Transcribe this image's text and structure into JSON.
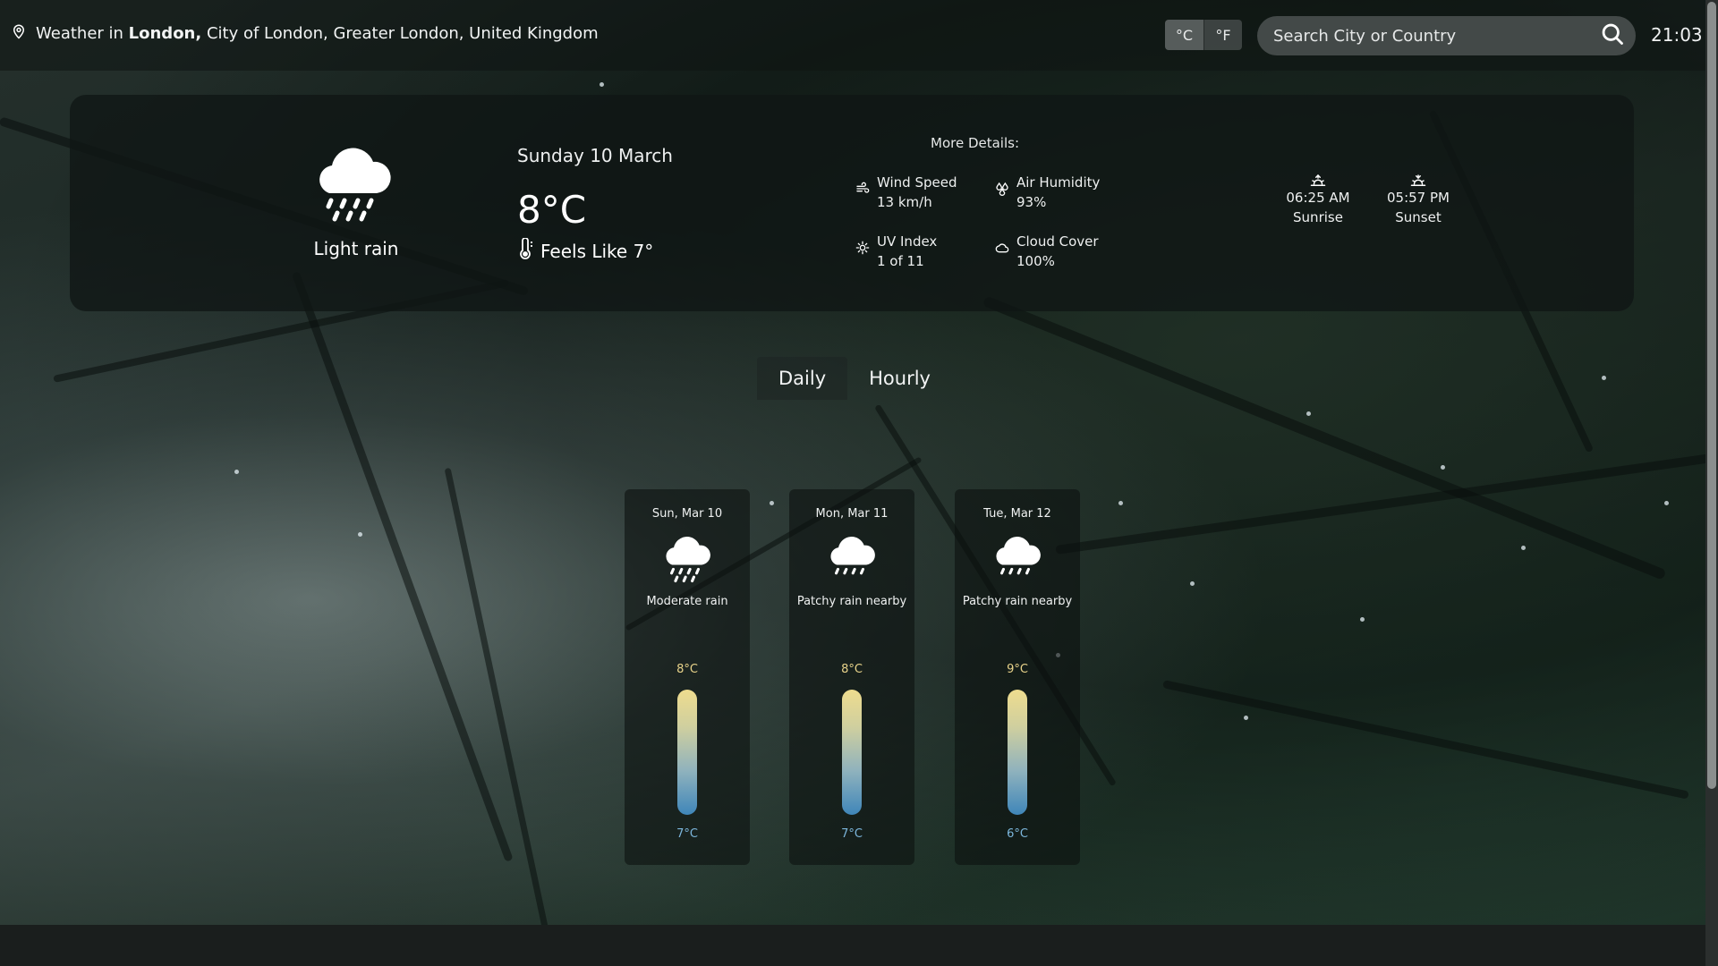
{
  "location": {
    "prefix": "Weather in",
    "city": "London,",
    "region": "City of London, Greater London, United Kingdom"
  },
  "units": {
    "celsius": "°C",
    "fahrenheit": "°F",
    "selected": "°C"
  },
  "search": {
    "placeholder": "Search City or Country",
    "value": ""
  },
  "clock": "21:03",
  "current": {
    "condition": "Light rain",
    "condition_icon": "rain-cloud-icon",
    "date": "Sunday 10 March",
    "temp": "8°C",
    "feels_like": "Feels Like 7°",
    "more_details_title": "More Details:",
    "details": {
      "wind_label": "Wind Speed",
      "wind_value": "13 km/h",
      "humidity_label": "Air Humidity",
      "humidity_value": "93%",
      "uv_label": "UV Index",
      "uv_value": "1 of 11",
      "cloud_label": "Cloud Cover",
      "cloud_value": "100%"
    },
    "sunrise_time": "06:25 AM",
    "sunrise_label": "Sunrise",
    "sunset_time": "05:57 PM",
    "sunset_label": "Sunset"
  },
  "tabs": {
    "daily": "Daily",
    "hourly": "Hourly",
    "active": "Daily"
  },
  "forecast": [
    {
      "day": "Sun, Mar 10",
      "condition": "Moderate rain",
      "high": "8°C",
      "low": "7°C",
      "icon": "rain-cloud-icon"
    },
    {
      "day": "Mon, Mar 11",
      "condition": "Patchy rain nearby",
      "high": "8°C",
      "low": "7°C",
      "icon": "rain-cloud-icon"
    },
    {
      "day": "Tue, Mar 12",
      "condition": "Patchy rain nearby",
      "high": "9°C",
      "low": "6°C",
      "icon": "rain-cloud-icon"
    }
  ],
  "colors": {
    "high_temp": "#e8d38a",
    "low_temp": "#7cb6dc",
    "panel": "#101614"
  }
}
